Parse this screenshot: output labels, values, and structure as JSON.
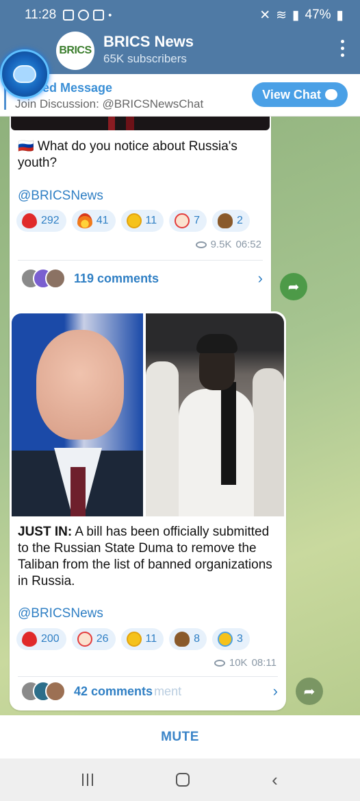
{
  "status_bar": {
    "time": "11:28",
    "battery": "47%"
  },
  "header": {
    "channel_name": "BRICS News",
    "subscribers": "65K subscribers",
    "avatar_text": "BRICS"
  },
  "pinned": {
    "title": "ed Message",
    "text": "Join Discussion: @BRICSNewsChat",
    "view_chat_label": "View Chat"
  },
  "posts": [
    {
      "text": "🇷🇺 What do you notice about Russia's youth?",
      "handle": "@BRICSNews",
      "reactions": [
        {
          "icon": "heart",
          "count": "292"
        },
        {
          "icon": "fire",
          "count": "41"
        },
        {
          "icon": "laughing",
          "count": "11"
        },
        {
          "icon": "clown",
          "count": "7"
        },
        {
          "icon": "poop",
          "count": "2"
        }
      ],
      "views": "9.5K",
      "time": "06:52",
      "comments": "119 comments"
    },
    {
      "lead": "JUST IN:",
      "text": " A bill has been officially submitted to the Russian State Duma to remove the Taliban from the list of banned organizations in Russia.",
      "handle": "@BRICSNews",
      "reactions": [
        {
          "icon": "heart",
          "count": "200"
        },
        {
          "icon": "clown",
          "count": "26"
        },
        {
          "icon": "laughing",
          "count": "11"
        },
        {
          "icon": "poop",
          "count": "8"
        },
        {
          "icon": "crying",
          "count": "3"
        }
      ],
      "views": "10K",
      "time": "08:11",
      "comments": "42 comments",
      "comments_ghost": "ment"
    }
  ],
  "mute_label": "MUTE",
  "colors": {
    "header": "#4f7aa5",
    "accent_blue": "#2f7fc4",
    "share_green": "#4d9a48"
  }
}
